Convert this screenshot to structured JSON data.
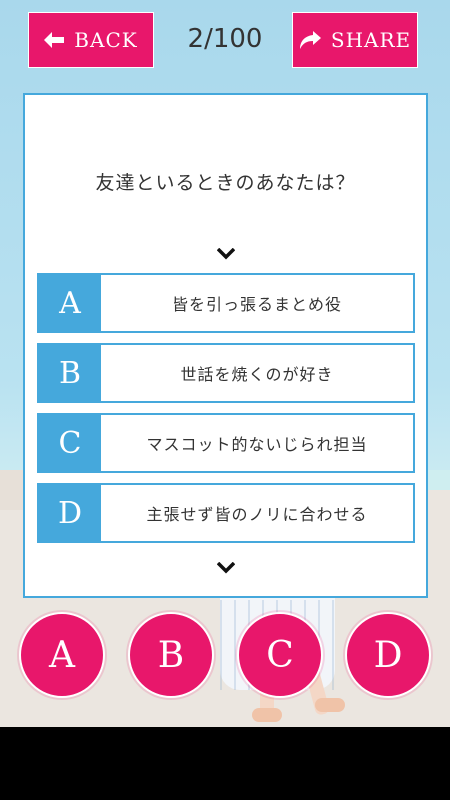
{
  "header": {
    "back_label": "BACK",
    "share_label": "SHARE",
    "progress": "2/100",
    "accent_color": "#e8176b"
  },
  "question": {
    "text": "友達といるときのあなたは？",
    "border_color": "#45a8dc"
  },
  "options": [
    {
      "letter": "A",
      "text": "皆を引っ張るまとめ役"
    },
    {
      "letter": "B",
      "text": "世話を焼くのが好き"
    },
    {
      "letter": "C",
      "text": "マスコット的ないじられ担当"
    },
    {
      "letter": "D",
      "text": "主張せず皆のノリに合わせる"
    }
  ],
  "answer_buttons": [
    "A",
    "B",
    "C",
    "D"
  ],
  "icons": {
    "back": "arrow-left-icon",
    "share": "share-arrow-icon",
    "scroll": "chevron-down-icon"
  }
}
